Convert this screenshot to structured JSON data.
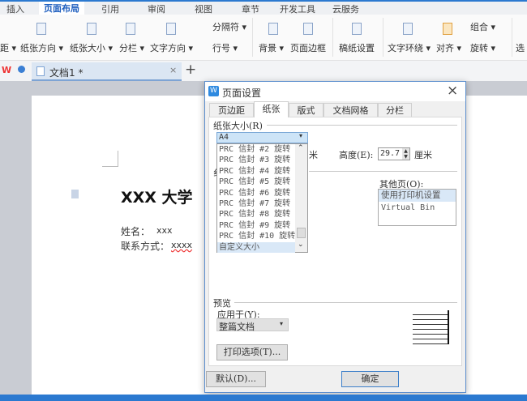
{
  "menubar": {
    "items": [
      "插入",
      "页面布局",
      "引用",
      "审阅",
      "视图",
      "章节",
      "开发工具",
      "云服务"
    ]
  },
  "ribbon": {
    "margins": "距 ▾",
    "orientation": "纸张方向 ▾",
    "size": "纸张大小 ▾",
    "columns": "分栏 ▾",
    "text_direction": "文字方向 ▾",
    "breaks": "分隔符 ▾",
    "line_numbers": "行号 ▾",
    "background": "背景 ▾",
    "page_border": "页面边框",
    "manuscript": "稿纸设置",
    "text_wrap": "文字环绕 ▾",
    "align": "对齐 ▾",
    "group": "组合 ▾",
    "rotate": "旋转 ▾",
    "select": "选"
  },
  "tabs": {
    "doc": "文档1 *",
    "close": "×",
    "new": "+"
  },
  "document": {
    "heading": "XXX 大学",
    "name_label": "姓名：",
    "name_value": "xxx",
    "contact_label": "联系方式：",
    "contact_value": "xxxx"
  },
  "dialog": {
    "title": "页面设置",
    "close": "×",
    "tabs": [
      "页边距",
      "纸张",
      "版式",
      "文档网格",
      "分栏"
    ],
    "paper_size_label": "纸张大小(R)",
    "paper_size_value": "A4",
    "paper_size_options": [
      "PRC 信封 #2 旋转",
      "PRC 信封 #3 旋转",
      "PRC 信封 #4 旋转",
      "PRC 信封 #5 旋转",
      "PRC 信封 #6 旋转",
      "PRC 信封 #7 旋转",
      "PRC 信封 #8 旋转",
      "PRC 信封 #9 旋转",
      "PRC 信封 #10 旋转",
      "自定义大小"
    ],
    "width_unit_stub": "米",
    "height_label": "高度(E):",
    "height_value": "29.7",
    "height_unit": "厘米",
    "source_stub": "纟",
    "other_pages_label": "其他页(O):",
    "other_pages_options": [
      "使用打印机设置",
      "Virtual Bin"
    ],
    "preview_label": "预览",
    "apply_label": "应用于(Y):",
    "apply_value": "整篇文档",
    "print_options": "打印选项(T)...",
    "default_btn": "默认(D)...",
    "ok_btn": "确定"
  }
}
